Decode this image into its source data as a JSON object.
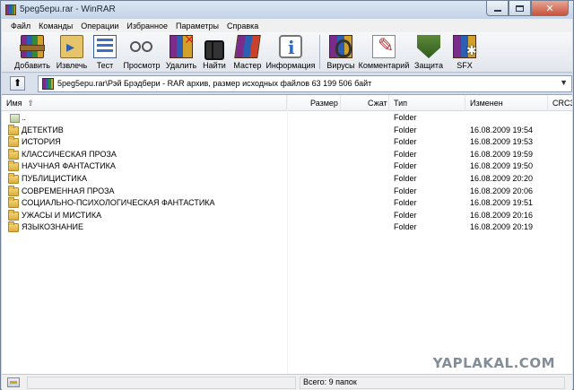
{
  "window": {
    "title": "5peg5epu.rar - WinRAR"
  },
  "menu": [
    "Файл",
    "Команды",
    "Операции",
    "Избранное",
    "Параметры",
    "Справка"
  ],
  "toolbar": [
    {
      "label": "Добавить",
      "icon": "add-archive-icon"
    },
    {
      "label": "Извлечь",
      "icon": "extract-icon"
    },
    {
      "label": "Тест",
      "icon": "test-icon"
    },
    {
      "label": "Просмотр",
      "icon": "view-icon"
    },
    {
      "label": "Удалить",
      "icon": "delete-icon"
    },
    {
      "label": "Найти",
      "icon": "find-icon"
    },
    {
      "label": "Мастер",
      "icon": "wizard-icon"
    },
    {
      "label": "Информация",
      "icon": "info-icon"
    },
    {
      "label": "Вирусы",
      "icon": "virus-scan-icon"
    },
    {
      "label": "Комментарий",
      "icon": "comment-icon"
    },
    {
      "label": "Защита",
      "icon": "protect-icon"
    },
    {
      "label": "SFX",
      "icon": "sfx-icon"
    }
  ],
  "address": {
    "path": "5peg5epu.rar\\Рэй Брэдбери - RAR архив, размер исходных файлов 63 199 506 байт"
  },
  "columns": {
    "name": "Имя",
    "size": "Размер",
    "packed": "Сжат",
    "type": "Тип",
    "modified": "Изменен",
    "crc": "CRC3"
  },
  "files": [
    {
      "name": "..",
      "type": "Folder",
      "modified": "",
      "updir": true
    },
    {
      "name": "ДЕТЕКТИВ",
      "type": "Folder",
      "modified": "16.08.2009 19:54"
    },
    {
      "name": "ИСТОРИЯ",
      "type": "Folder",
      "modified": "16.08.2009 19:53"
    },
    {
      "name": "КЛАССИЧЕСКАЯ ПРОЗА",
      "type": "Folder",
      "modified": "16.08.2009 19:59"
    },
    {
      "name": "НАУЧНАЯ ФАНТАСТИКА",
      "type": "Folder",
      "modified": "16.08.2009 19:50"
    },
    {
      "name": "ПУБЛИЦИСТИКА",
      "type": "Folder",
      "modified": "16.08.2009 20:20"
    },
    {
      "name": "СОВРЕМЕННАЯ ПРОЗА",
      "type": "Folder",
      "modified": "16.08.2009 20:06"
    },
    {
      "name": "СОЦИАЛЬНО-ПСИХОЛОГИЧЕСКАЯ ФАНТАСТИКА",
      "type": "Folder",
      "modified": "16.08.2009 19:51"
    },
    {
      "name": "УЖАСЫ И МИСТИКА",
      "type": "Folder",
      "modified": "16.08.2009 20:16"
    },
    {
      "name": "ЯЗЫКОЗНАНИЕ",
      "type": "Folder",
      "modified": "16.08.2009 20:19"
    }
  ],
  "status": {
    "left": "",
    "right": "Всего: 9 папок"
  },
  "watermark": "YAPLAKAL.COM"
}
